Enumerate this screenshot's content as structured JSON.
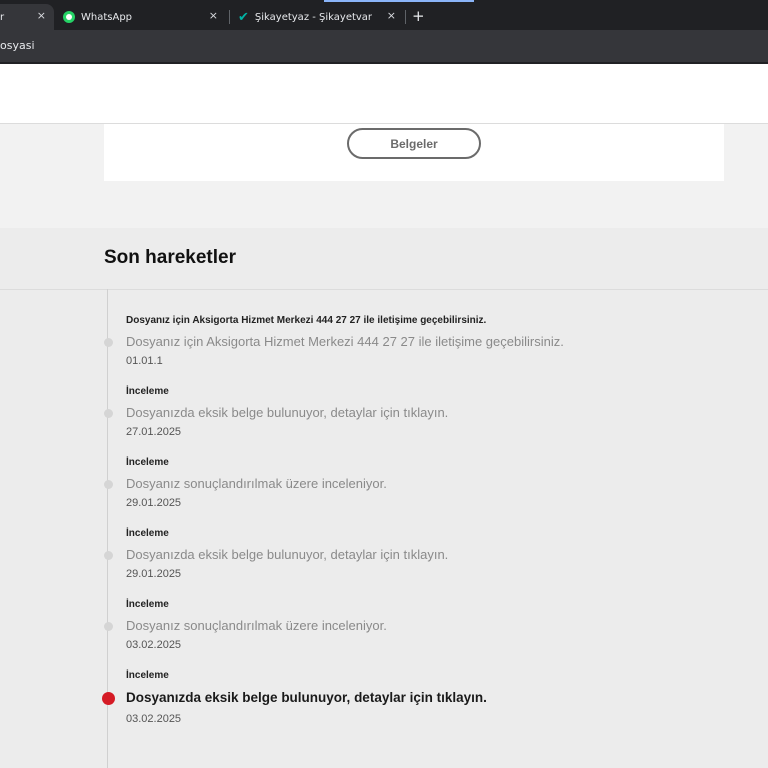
{
  "browser": {
    "tabs": [
      {
        "label": "r",
        "active": true
      },
      {
        "label": "WhatsApp",
        "icon": "whatsapp-icon"
      },
      {
        "label": "Şikayetyaz - Şikayetvar",
        "icon": "check-icon"
      }
    ],
    "new_tab": "+",
    "close": "×",
    "breadcrumb": "osyasi"
  },
  "card": {
    "button_label": "Belgeler"
  },
  "activity": {
    "heading": "Son hareketler",
    "events": [
      {
        "title": "Dosyanız için Aksigorta Hizmet Merkezi 444 27 27 ile iletişime geçebilirsiniz.",
        "description": "Dosyanız için Aksigorta Hizmet Merkezi 444 27 27 ile iletişime geçebilirsiniz.",
        "date": "01.01.1"
      },
      {
        "title": "İnceleme",
        "description": "Dosyanızda eksik belge bulunuyor, detaylar için tıklayın.",
        "date": "27.01.2025"
      },
      {
        "title": "İnceleme",
        "description": "Dosyanız sonuçlandırılmak üzere inceleniyor.",
        "date": "29.01.2025"
      },
      {
        "title": "İnceleme",
        "description": "Dosyanızda eksik belge bulunuyor, detaylar için tıklayın.",
        "date": "29.01.2025"
      },
      {
        "title": "İnceleme",
        "description": "Dosyanız sonuçlandırılmak üzere inceleniyor.",
        "date": "03.02.2025"
      },
      {
        "title": "İnceleme",
        "description": "Dosyanızda eksik belge bulunuyor, detaylar için tıklayın.",
        "date": "03.02.2025",
        "current": true
      }
    ]
  },
  "colors": {
    "accent": "#d51b25",
    "inactive_dot": "#d5d5d5",
    "whatsapp": "#25d366",
    "sikayetvar": "#00b3a4"
  }
}
